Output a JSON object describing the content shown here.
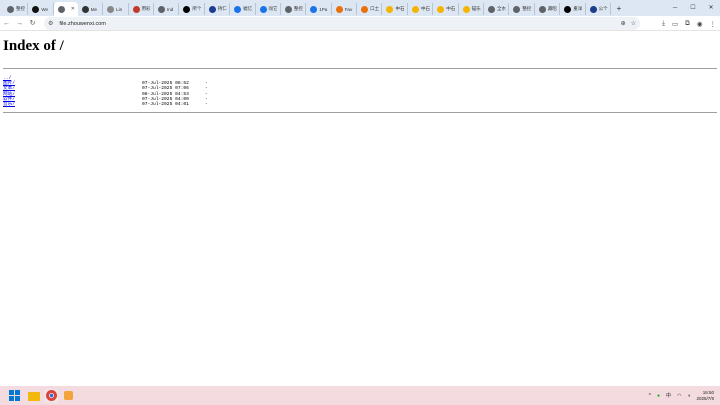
{
  "tabs": [
    {
      "label": "整控",
      "color": "#5f6368"
    },
    {
      "label": "We",
      "color": "#111111"
    },
    {
      "label": "",
      "color": "#5f6368",
      "active": true
    },
    {
      "label": "Me",
      "color": "#333333"
    },
    {
      "label": "Lin",
      "color": "#888888"
    },
    {
      "label": "用彩",
      "color": "#c0392b"
    },
    {
      "label": "Ind",
      "color": "#5f6368"
    },
    {
      "label": "所个",
      "color": "#000000"
    },
    {
      "label": "持仁",
      "color": "#1a3d8f"
    },
    {
      "label": "嘘亿",
      "color": "#1a73e8"
    },
    {
      "label": "闯它",
      "color": "#1a73e8"
    },
    {
      "label": "整控",
      "color": "#5f6368"
    },
    {
      "label": "1Pa",
      "color": "#1a73e8"
    },
    {
      "label": "Fav",
      "color": "#e8710a"
    },
    {
      "label": "口土",
      "color": "#e8710a"
    },
    {
      "label": "中石",
      "color": "#f4b400"
    },
    {
      "label": "中石",
      "color": "#f4b400"
    },
    {
      "label": "中石",
      "color": "#f4b400"
    },
    {
      "label": "锚乐",
      "color": "#f4b400"
    },
    {
      "label": "全水",
      "color": "#5f6368"
    },
    {
      "label": "整控",
      "color": "#5f6368"
    },
    {
      "label": "藏昭",
      "color": "#5f6368"
    },
    {
      "label": "重洋",
      "color": "#000000"
    },
    {
      "label": "公个",
      "color": "#1a3d8f"
    }
  ],
  "address": {
    "url": "file.zhouwenxi.com"
  },
  "page": {
    "title": "Index of /"
  },
  "entries": [
    {
      "name": "../",
      "date": "",
      "size": ""
    },
    {
      "name": "图片/",
      "date": "07-Jul-2025 06:52",
      "size": "-"
    },
    {
      "name": "文本/",
      "date": "07-Jul-2025 07:06",
      "size": "-"
    },
    {
      "name": "网站/",
      "date": "08-Jul-2025 04:53",
      "size": "-"
    },
    {
      "name": "软件/",
      "date": "07-Jul-2025 04:00",
      "size": "-"
    },
    {
      "name": "音乐/",
      "date": "07-Jul-2025 04:01",
      "size": "-"
    }
  ],
  "taskbar": {
    "time": "16:50",
    "date": "2025/7/9",
    "ime": "中",
    "colors": {
      "start": "#0078d4",
      "files": "#f2b90c",
      "chrome": "#db4437"
    }
  }
}
